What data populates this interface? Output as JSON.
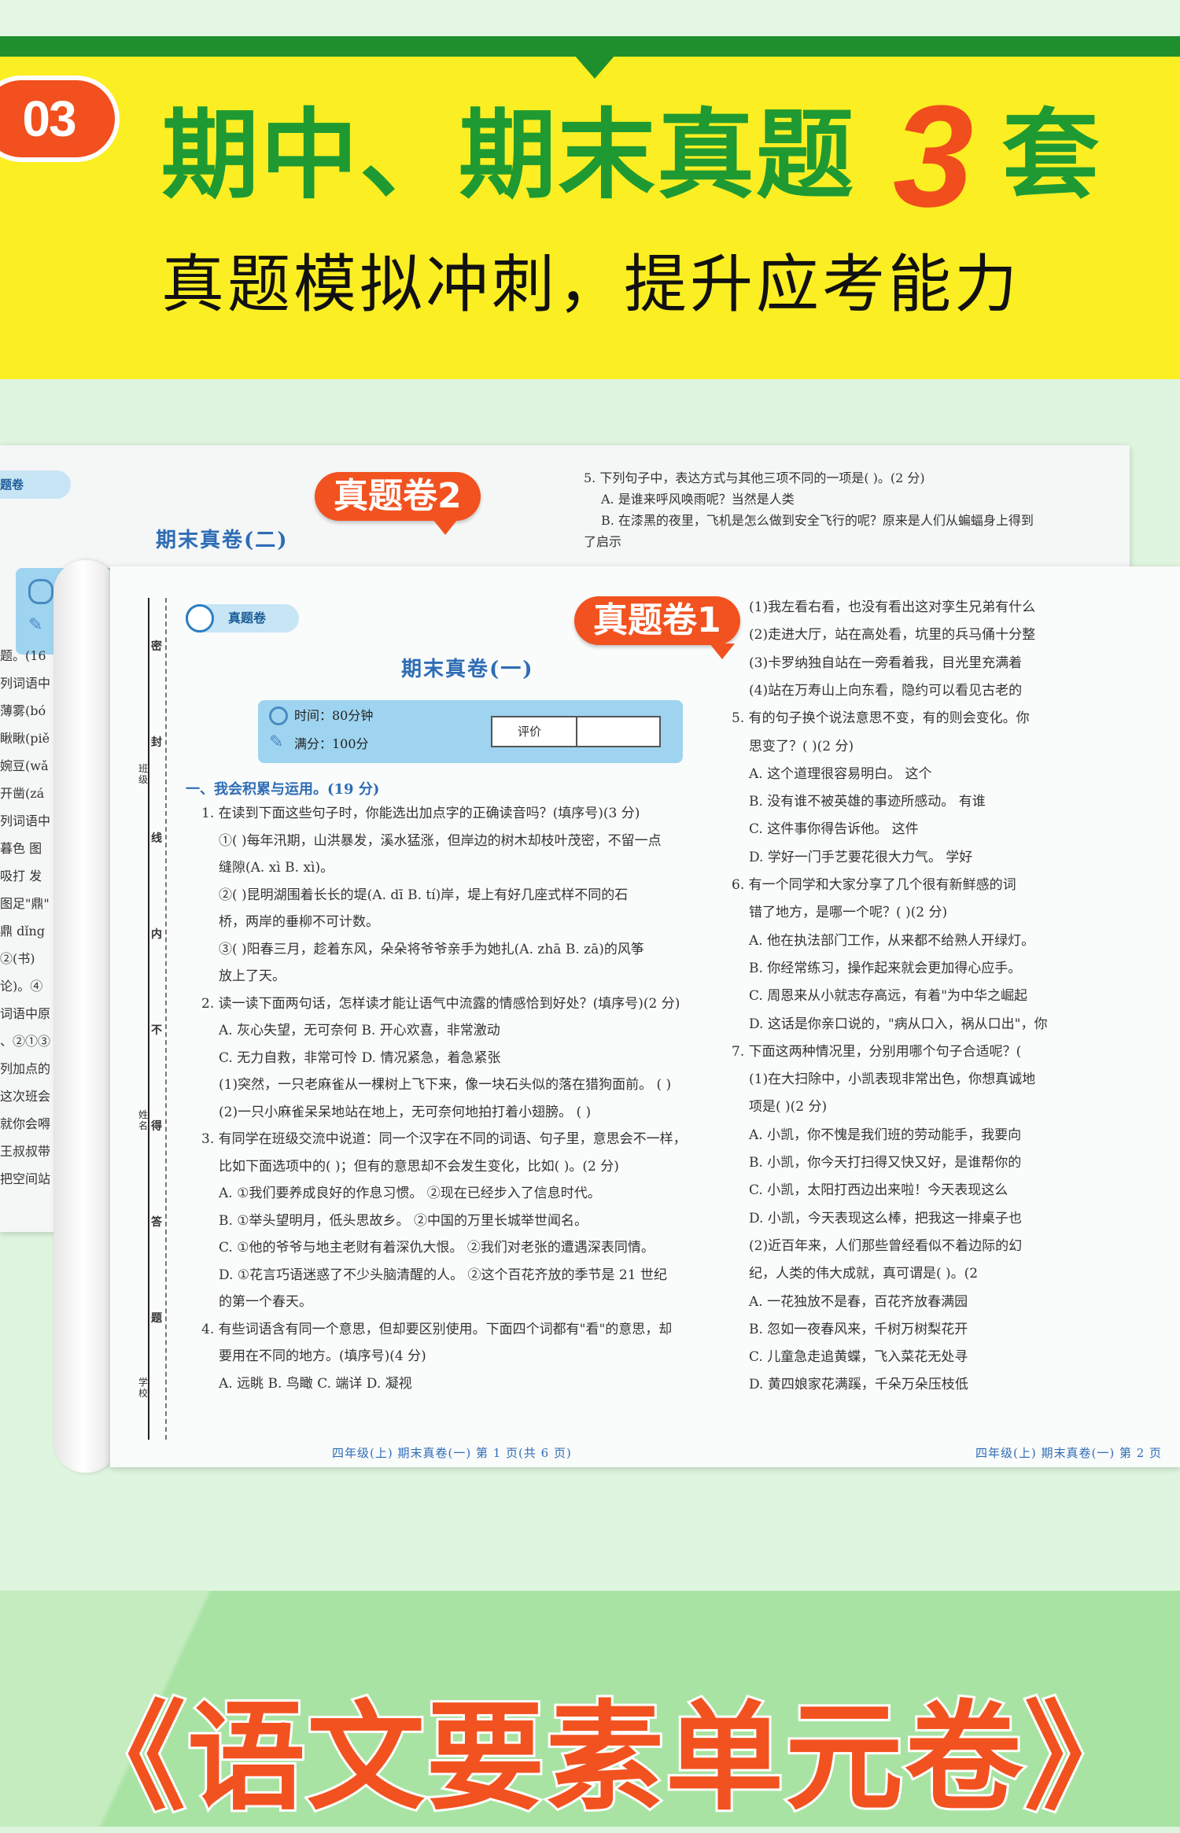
{
  "banner": {
    "badge": "03",
    "headline_a": "期中、期末真题",
    "headline_num": "3",
    "headline_b": "套",
    "subline": "真题模拟冲刺，提升应考能力",
    "colors": {
      "green": "#1f9a32",
      "yellow": "#fbee22",
      "orange": "#f04e1c"
    }
  },
  "back_paper": {
    "tag": "真题卷2",
    "logo": "题卷",
    "title": "期末真卷(二)",
    "left_fragments": [
      "题。(16",
      "列词语中",
      "薄雾(bó",
      "瞅瞅(piě",
      "婉豆(wǎ",
      "开凿(zá",
      "列词语中",
      "暮色  图",
      "吸打  发",
      "图足\"鼎\"",
      "鼎 dǐng",
      "②(书)",
      "论)。④",
      "词语中原",
      "、②①③",
      "列加点的",
      "这次班会",
      "就你会嘚",
      "王叔叔带",
      "把空间站"
    ],
    "right_lines": [
      "5. 下列句子中，表达方式与其他三项不同的一项是(        )。(2 分)",
      "A. 是谁来呼风唤雨呢？当然是人类",
      "B. 在漆黑的夜里，飞机是怎么做到安全飞行的呢？原来是人们从蝙蝠身上得到",
      "了启示"
    ]
  },
  "front_paper": {
    "tag": "真题卷1",
    "logo": "真题卷",
    "title": "期末真卷(一)",
    "time_label": "时间：80分钟",
    "score_label": "满分：100分",
    "eval_label": "评价",
    "binding_chars": [
      "密",
      "封",
      "线",
      "内",
      "不",
      "得",
      "答",
      "题"
    ],
    "binding_fields": [
      "班级",
      "姓名",
      "学校"
    ],
    "section1": "一、我会积累与运用。(19 分)",
    "left_lines": [
      "1. 在读到下面这些句子时，你能选出加点字的正确读音吗？(填序号)(3 分)",
      "①(        )每年汛期，山洪暴发，溪水猛涨，但岸边的树木却枝叶茂密，不留一点",
      "缝隙(A. xì    B. xì)。",
      "②(        )昆明湖围着长长的堤(A. dī    B. tí)岸，堤上有好几座式样不同的石",
      "桥，两岸的垂柳不可计数。",
      "③(        )阳春三月，趁着东风，朵朵将爷爷亲手为她扎(A. zhā    B. zā)的风筝",
      "放上了天。",
      "2. 读一读下面两句话，怎样读才能让语气中流露的情感恰到好处？(填序号)(2 分)",
      "A. 灰心失望，无可奈何              B. 开心欢喜，非常激动",
      "C. 无力自救，非常可怜              D. 情况紧急，着急紧张",
      "(1)突然，一只老麻雀从一棵树上飞下来，像一块石头似的落在猎狗面前。  (        )",
      "(2)一只小麻雀呆呆地站在地上，无可奈何地拍打着小翅膀。              (        )",
      "3. 有同学在班级交流中说道：同一个汉字在不同的词语、句子里，意思会不一样，",
      "比如下面选项中的(        )；但有的意思却不会发生变化，比如(        )。(2 分)",
      "A. ①我们要养成良好的作息习惯。          ②现在已经步入了信息时代。",
      "B. ①举头望明月，低头思故乡。            ②中国的万里长城举世闻名。",
      "C. ①他的爷爷与地主老财有着深仇大恨。    ②我们对老张的遭遇深表同情。",
      "D. ①花言巧语迷惑了不少头脑清醒的人。    ②这个百花齐放的季节是 21 世纪",
      "的第一个春天。",
      "4. 有些词语含有同一个意思，但却要区别使用。下面四个词都有\"看\"的意思，却",
      "要用在不同的地方。(填序号)(4 分)",
      "A. 远眺            B. 鸟瞰            C. 端详            D. 凝视"
    ],
    "right_lines": [
      "(1)我左看右看，也没有看出这对孪生兄弟有什么",
      "(2)走进大厅，站在高处看，坑里的兵马俑十分整",
      "(3)卡罗纳独自站在一旁看着我，目光里充满着",
      "(4)站在万寿山上向东看，隐约可以看见古老的",
      "5. 有的句子换个说法意思不变，有的则会变化。你",
      "思变了？(        )(2 分)",
      "A. 这个道理很容易明白。                 这个",
      "B. 没有谁不被英雄的事迹所感动。          有谁",
      "C. 这件事你得告诉他。                   这件",
      "D. 学好一门手艺要花很大力气。            学好",
      "6. 有一个同学和大家分享了几个很有新鲜感的词",
      "错了地方，是哪一个呢？(        )(2 分)",
      "A. 他在执法部门工作，从来都不给熟人开绿灯。",
      "B. 你经常练习，操作起来就会更加得心应手。",
      "C. 周恩来从小就志存高远，有着\"为中华之崛起",
      "D. 这话是你亲口说的，\"病从口入，祸从口出\"，你",
      "7. 下面这两种情况里，分别用哪个句子合适呢？(",
      "(1)在大扫除中，小凯表现非常出色，你想真诚地",
      "项是(        )(2 分)",
      "A. 小凯，你不愧是我们班的劳动能手，我要向",
      "B. 小凯，你今天打扫得又快又好，是谁帮你的",
      "C. 小凯，太阳打西边出来啦！今天表现这么",
      "D. 小凯，今天表现这么棒，把我这一排桌子也",
      "(2)近百年来，人们那些曾经看似不着边际的幻",
      "纪，人类的伟大成就，真可谓是(        )。(2",
      "A. 一花独放不是春，百花齐放春满园",
      "B. 忽如一夜春风来，千树万树梨花开",
      "C. 儿童急走追黄蝶，飞入菜花无处寻",
      "D. 黄四娘家花满蹊，千朵万朵压枝低"
    ],
    "footer_left": "四年级(上)  期末真卷(一)  第 1 页(共 6 页)",
    "footer_right": "四年级(上)  期末真卷(一)  第 2 页"
  },
  "bottom": {
    "title": "《语文要素单元卷》"
  }
}
